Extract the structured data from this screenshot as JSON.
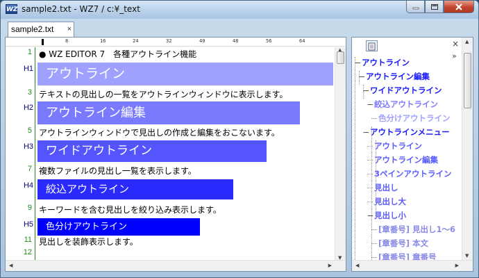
{
  "window": {
    "app_icon_text": "WZ",
    "title": "sample2.txt - WZ7 / c:¥_text"
  },
  "tabs": [
    {
      "label": "sample2.txt",
      "close": "×"
    }
  ],
  "ruler": {
    "marks": [
      "8",
      "16",
      "24",
      "32",
      "40",
      "48",
      "56",
      "64"
    ]
  },
  "editor": {
    "lines": [
      {
        "no": "1",
        "text": "● WZ EDITOR 7　各種アウトライン機能"
      },
      {
        "no": "H1",
        "text": "アウトライン",
        "heading": true,
        "color": "#a0a0ff"
      },
      {
        "no": "3",
        "text": "テキストの見出しの一覧をアウトラインウィンドウに表示します。"
      },
      {
        "no": "H2",
        "text": "アウトライン編集",
        "heading": true,
        "color": "#7a7aff"
      },
      {
        "no": "5",
        "text": "アウトラインウィンドウで見出しの作成と編集をおこないます。"
      },
      {
        "no": "H3",
        "text": "ワイドアウトライン",
        "heading": true,
        "color": "#5555ff"
      },
      {
        "no": "7",
        "text": "複数ファイルの見出し一覧を表示します。"
      },
      {
        "no": "H4",
        "text": "絞込アウトライン",
        "heading": true,
        "color": "#2a2aff"
      },
      {
        "no": "9",
        "text": "キーワードを含む見出しを絞り込み表示します。"
      },
      {
        "no": "H5",
        "text": "色分けアウトライン",
        "heading": true,
        "color": "#0000ff"
      },
      {
        "no": "11",
        "text": "見出しを装飾表示します。"
      },
      {
        "no": "12",
        "text": ""
      }
    ]
  },
  "outline": {
    "close": "×",
    "more": "»",
    "nodes": [
      {
        "label": "アウトライン",
        "color": "#1a1aff"
      },
      {
        "label": "アウトライン編集",
        "color": "#1a1aff"
      },
      {
        "label": "ワイドアウトライン",
        "color": "#1a1aff"
      },
      {
        "label": "絞込アウトライン",
        "color": "#7a7aff"
      },
      {
        "label": "色分けアウトライン",
        "color": "#a0a0ff"
      },
      {
        "label": "アウトラインメニュー",
        "color": "#1a1aff"
      },
      {
        "label": "アウトライン",
        "color": "#5a5aff"
      },
      {
        "label": "アウトライン編集",
        "color": "#5a5aff"
      },
      {
        "label": "3ペインアウトライン",
        "color": "#5a5aff"
      },
      {
        "label": "見出し",
        "color": "#5a5aff"
      },
      {
        "label": "見出し大",
        "color": "#5a5aff"
      },
      {
        "label": "見出し小",
        "color": "#5a5aff"
      },
      {
        "label": "[章番号] 見出し1～6",
        "color": "#8a8ae8"
      },
      {
        "label": "[章番号] 本文",
        "color": "#8a8ae8"
      },
      {
        "label": "[章番号] 章番号",
        "color": "#8a8ae8"
      }
    ]
  },
  "colors": {
    "gutter": "#1c8a1c",
    "heading_number": "#000080"
  }
}
